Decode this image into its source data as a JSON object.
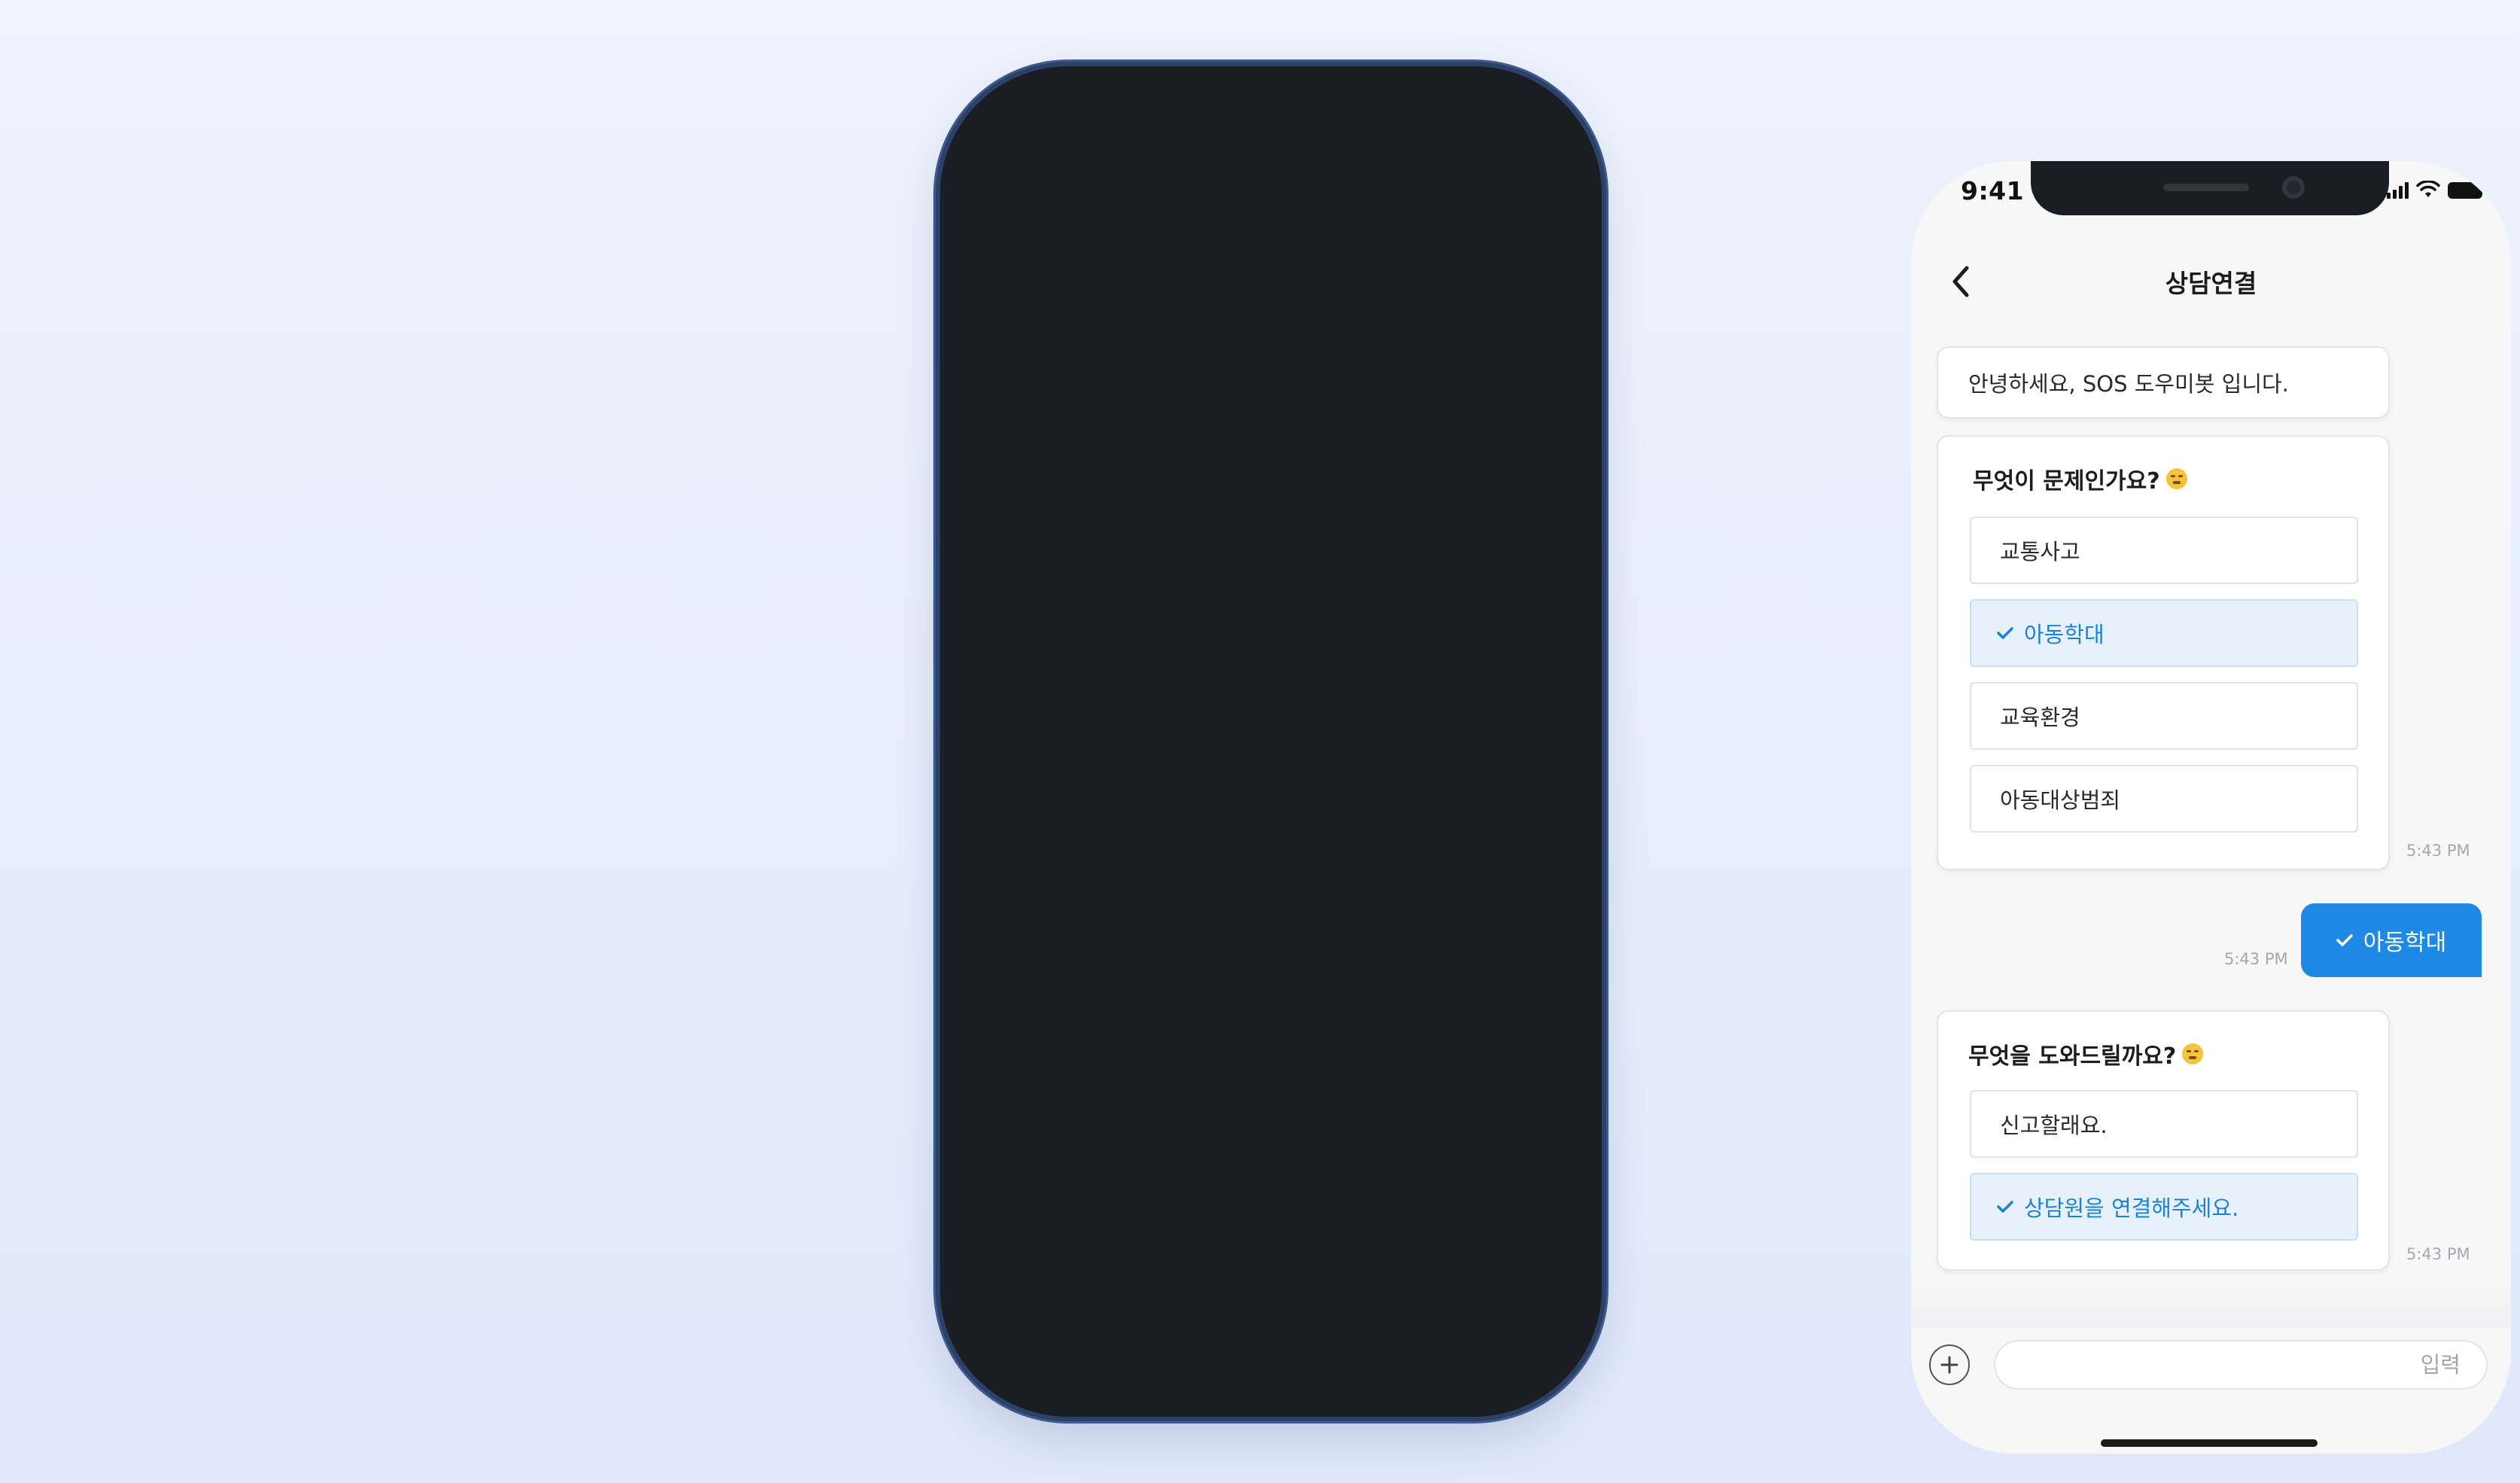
{
  "status": {
    "time": "9:41"
  },
  "header": {
    "title": "상담연결"
  },
  "chat": {
    "greeting": "안녕하세요, SOS 도우미봇 입니다.",
    "question1": {
      "text": "무엇이 문제인가요?",
      "options": [
        "교통사고",
        "아동학대",
        "교육환경",
        "아동대상범죄"
      ],
      "selected": "아동학대",
      "time": "5:43 PM"
    },
    "reply": {
      "text": "아동학대",
      "time": "5:43 PM"
    },
    "question2": {
      "text": "무엇을 도와드릴까요?",
      "options": [
        "신고할래요.",
        "상담원을 연결해주세요."
      ],
      "selected": "상담원을 연결해주세요.",
      "time": "5:43 PM"
    }
  },
  "input": {
    "placeholder": "입력"
  },
  "colors": {
    "accent": "#1e88e5",
    "selected_bg": "#e6f1fc",
    "background": "#eef3fd"
  },
  "icons": [
    "back-arrow-icon",
    "check-icon",
    "plus-circle-icon",
    "signal-icon",
    "wifi-icon",
    "battery-icon",
    "emoji-icon"
  ]
}
